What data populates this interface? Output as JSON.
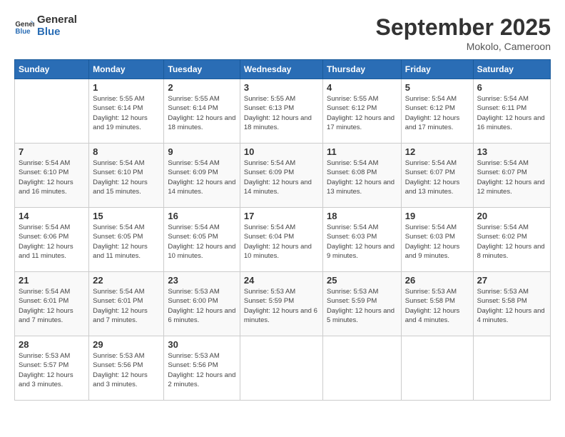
{
  "header": {
    "logo_line1": "General",
    "logo_line2": "Blue",
    "month_title": "September 2025",
    "location": "Mokolo, Cameroon"
  },
  "weekdays": [
    "Sunday",
    "Monday",
    "Tuesday",
    "Wednesday",
    "Thursday",
    "Friday",
    "Saturday"
  ],
  "weeks": [
    [
      {
        "day": "",
        "sunrise": "",
        "sunset": "",
        "daylight": ""
      },
      {
        "day": "1",
        "sunrise": "Sunrise: 5:55 AM",
        "sunset": "Sunset: 6:14 PM",
        "daylight": "Daylight: 12 hours and 19 minutes."
      },
      {
        "day": "2",
        "sunrise": "Sunrise: 5:55 AM",
        "sunset": "Sunset: 6:14 PM",
        "daylight": "Daylight: 12 hours and 18 minutes."
      },
      {
        "day": "3",
        "sunrise": "Sunrise: 5:55 AM",
        "sunset": "Sunset: 6:13 PM",
        "daylight": "Daylight: 12 hours and 18 minutes."
      },
      {
        "day": "4",
        "sunrise": "Sunrise: 5:55 AM",
        "sunset": "Sunset: 6:12 PM",
        "daylight": "Daylight: 12 hours and 17 minutes."
      },
      {
        "day": "5",
        "sunrise": "Sunrise: 5:54 AM",
        "sunset": "Sunset: 6:12 PM",
        "daylight": "Daylight: 12 hours and 17 minutes."
      },
      {
        "day": "6",
        "sunrise": "Sunrise: 5:54 AM",
        "sunset": "Sunset: 6:11 PM",
        "daylight": "Daylight: 12 hours and 16 minutes."
      }
    ],
    [
      {
        "day": "7",
        "sunrise": "Sunrise: 5:54 AM",
        "sunset": "Sunset: 6:10 PM",
        "daylight": "Daylight: 12 hours and 16 minutes."
      },
      {
        "day": "8",
        "sunrise": "Sunrise: 5:54 AM",
        "sunset": "Sunset: 6:10 PM",
        "daylight": "Daylight: 12 hours and 15 minutes."
      },
      {
        "day": "9",
        "sunrise": "Sunrise: 5:54 AM",
        "sunset": "Sunset: 6:09 PM",
        "daylight": "Daylight: 12 hours and 14 minutes."
      },
      {
        "day": "10",
        "sunrise": "Sunrise: 5:54 AM",
        "sunset": "Sunset: 6:09 PM",
        "daylight": "Daylight: 12 hours and 14 minutes."
      },
      {
        "day": "11",
        "sunrise": "Sunrise: 5:54 AM",
        "sunset": "Sunset: 6:08 PM",
        "daylight": "Daylight: 12 hours and 13 minutes."
      },
      {
        "day": "12",
        "sunrise": "Sunrise: 5:54 AM",
        "sunset": "Sunset: 6:07 PM",
        "daylight": "Daylight: 12 hours and 13 minutes."
      },
      {
        "day": "13",
        "sunrise": "Sunrise: 5:54 AM",
        "sunset": "Sunset: 6:07 PM",
        "daylight": "Daylight: 12 hours and 12 minutes."
      }
    ],
    [
      {
        "day": "14",
        "sunrise": "Sunrise: 5:54 AM",
        "sunset": "Sunset: 6:06 PM",
        "daylight": "Daylight: 12 hours and 11 minutes."
      },
      {
        "day": "15",
        "sunrise": "Sunrise: 5:54 AM",
        "sunset": "Sunset: 6:05 PM",
        "daylight": "Daylight: 12 hours and 11 minutes."
      },
      {
        "day": "16",
        "sunrise": "Sunrise: 5:54 AM",
        "sunset": "Sunset: 6:05 PM",
        "daylight": "Daylight: 12 hours and 10 minutes."
      },
      {
        "day": "17",
        "sunrise": "Sunrise: 5:54 AM",
        "sunset": "Sunset: 6:04 PM",
        "daylight": "Daylight: 12 hours and 10 minutes."
      },
      {
        "day": "18",
        "sunrise": "Sunrise: 5:54 AM",
        "sunset": "Sunset: 6:03 PM",
        "daylight": "Daylight: 12 hours and 9 minutes."
      },
      {
        "day": "19",
        "sunrise": "Sunrise: 5:54 AM",
        "sunset": "Sunset: 6:03 PM",
        "daylight": "Daylight: 12 hours and 9 minutes."
      },
      {
        "day": "20",
        "sunrise": "Sunrise: 5:54 AM",
        "sunset": "Sunset: 6:02 PM",
        "daylight": "Daylight: 12 hours and 8 minutes."
      }
    ],
    [
      {
        "day": "21",
        "sunrise": "Sunrise: 5:54 AM",
        "sunset": "Sunset: 6:01 PM",
        "daylight": "Daylight: 12 hours and 7 minutes."
      },
      {
        "day": "22",
        "sunrise": "Sunrise: 5:54 AM",
        "sunset": "Sunset: 6:01 PM",
        "daylight": "Daylight: 12 hours and 7 minutes."
      },
      {
        "day": "23",
        "sunrise": "Sunrise: 5:53 AM",
        "sunset": "Sunset: 6:00 PM",
        "daylight": "Daylight: 12 hours and 6 minutes."
      },
      {
        "day": "24",
        "sunrise": "Sunrise: 5:53 AM",
        "sunset": "Sunset: 5:59 PM",
        "daylight": "Daylight: 12 hours and 6 minutes."
      },
      {
        "day": "25",
        "sunrise": "Sunrise: 5:53 AM",
        "sunset": "Sunset: 5:59 PM",
        "daylight": "Daylight: 12 hours and 5 minutes."
      },
      {
        "day": "26",
        "sunrise": "Sunrise: 5:53 AM",
        "sunset": "Sunset: 5:58 PM",
        "daylight": "Daylight: 12 hours and 4 minutes."
      },
      {
        "day": "27",
        "sunrise": "Sunrise: 5:53 AM",
        "sunset": "Sunset: 5:58 PM",
        "daylight": "Daylight: 12 hours and 4 minutes."
      }
    ],
    [
      {
        "day": "28",
        "sunrise": "Sunrise: 5:53 AM",
        "sunset": "Sunset: 5:57 PM",
        "daylight": "Daylight: 12 hours and 3 minutes."
      },
      {
        "day": "29",
        "sunrise": "Sunrise: 5:53 AM",
        "sunset": "Sunset: 5:56 PM",
        "daylight": "Daylight: 12 hours and 3 minutes."
      },
      {
        "day": "30",
        "sunrise": "Sunrise: 5:53 AM",
        "sunset": "Sunset: 5:56 PM",
        "daylight": "Daylight: 12 hours and 2 minutes."
      },
      {
        "day": "",
        "sunrise": "",
        "sunset": "",
        "daylight": ""
      },
      {
        "day": "",
        "sunrise": "",
        "sunset": "",
        "daylight": ""
      },
      {
        "day": "",
        "sunrise": "",
        "sunset": "",
        "daylight": ""
      },
      {
        "day": "",
        "sunrise": "",
        "sunset": "",
        "daylight": ""
      }
    ]
  ]
}
